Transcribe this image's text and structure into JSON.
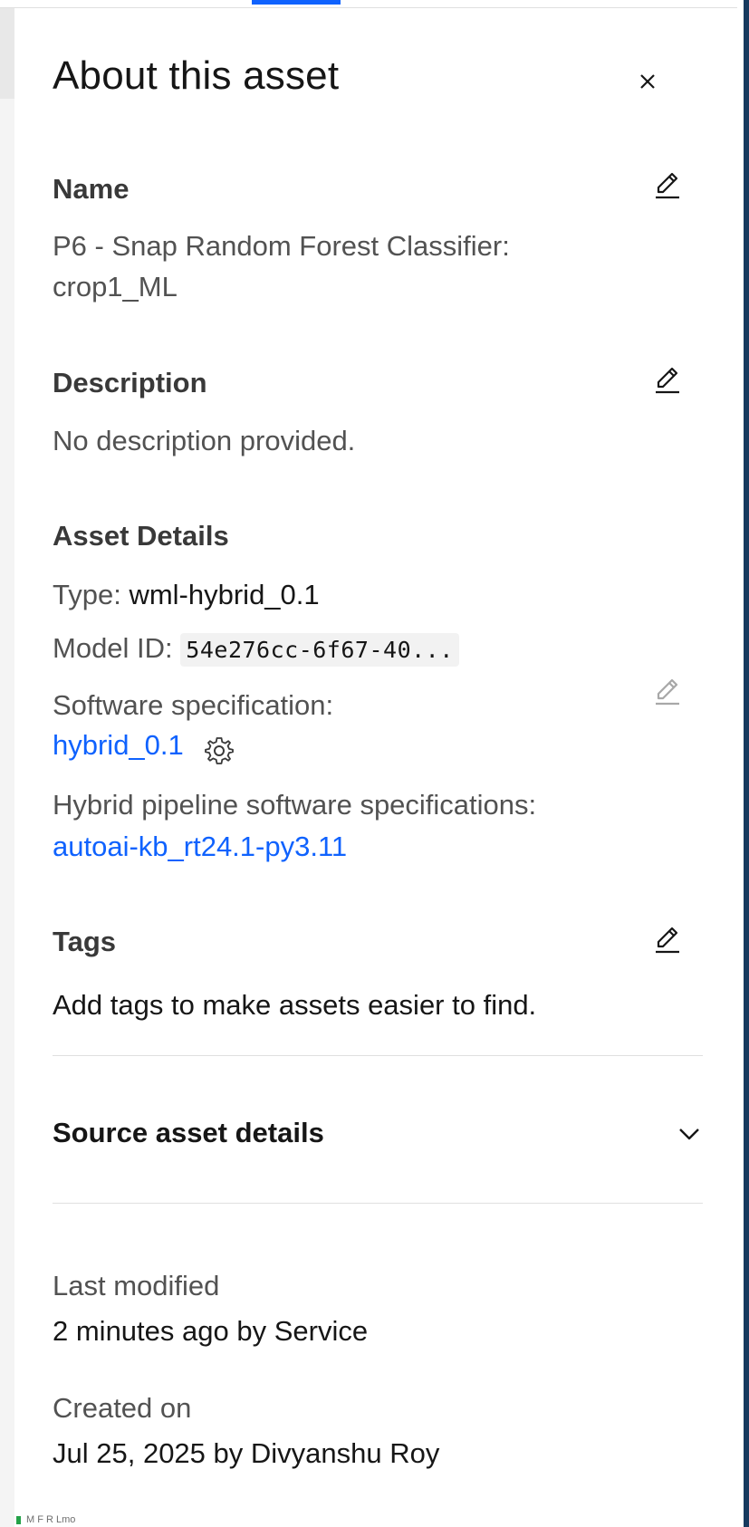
{
  "panel": {
    "title": "About this asset",
    "close_label": "×"
  },
  "name": {
    "label": "Name",
    "value_line1": "P6 - Snap Random Forest Classifier:",
    "value_line2": "crop1_ML"
  },
  "description": {
    "label": "Description",
    "value": "No description provided."
  },
  "asset_details": {
    "label": "Asset Details",
    "type_label": "Type:",
    "type_value": "wml-hybrid_0.1",
    "model_id_label": "Model ID:",
    "model_id_value": "54e276cc-6f67-40...",
    "software_spec_label": "Software specification:",
    "software_spec_value": "hybrid_0.1",
    "hybrid_spec_label": "Hybrid pipeline software specifications:",
    "hybrid_spec_value": "autoai-kb_rt24.1-py3.11"
  },
  "tags": {
    "label": "Tags",
    "value": "Add tags to make assets easier to find."
  },
  "source_asset": {
    "label": "Source asset details"
  },
  "meta": {
    "last_modified_label": "Last modified",
    "last_modified_value": "2 minutes ago by Service",
    "created_label": "Created on",
    "created_value": "Jul 25, 2025 by Divyanshu Roy"
  },
  "footer": {
    "tiny_text": "M F R Lmo"
  },
  "colors": {
    "link": "#0f62fe",
    "accent_bar": "#163a5f",
    "muted_text": "#525252"
  },
  "icons": [
    "close-icon",
    "pencil-icon",
    "gear-icon",
    "chevron-down-icon"
  ]
}
